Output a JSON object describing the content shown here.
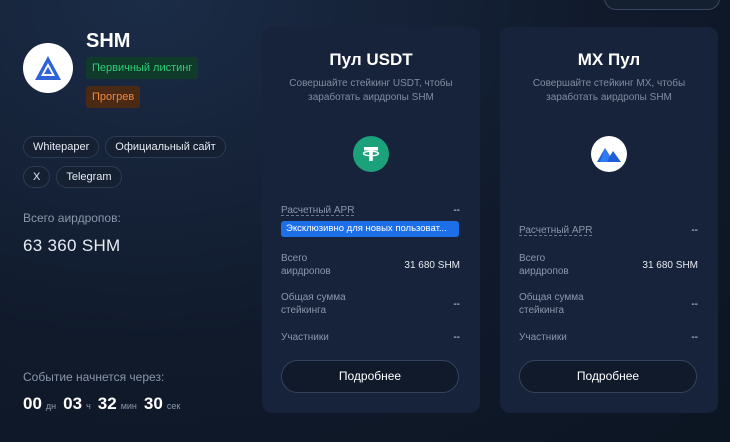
{
  "token": {
    "name": "SHM",
    "badges": [
      "Первичный листинг",
      "Прогрев"
    ],
    "links": [
      "Whitepaper",
      "Официальный сайт",
      "X",
      "Telegram"
    ],
    "total_airdrops_label": "Всего аирдропов:",
    "total_airdrops_value": "63 360 SHM"
  },
  "event": {
    "label": "Событие начнется через:",
    "days": "00",
    "days_unit": "дн",
    "hours": "03",
    "hours_unit": "ч",
    "minutes": "32",
    "minutes_unit": "мин",
    "seconds": "30",
    "seconds_unit": "сек"
  },
  "pools": [
    {
      "title": "Пул USDT",
      "description": "Совершайте стейкинг USDT, чтобы заработать аирдропы SHM",
      "icon": "tether-icon",
      "apr_label": "Расчетный APR",
      "apr_value": "--",
      "exclusive_label": "Эксклюзивно для новых пользоват...",
      "total_label": "Всего аирдропов",
      "total_value": "31 680 SHM",
      "staking_label": "Общая сумма стейкинга",
      "staking_value": "--",
      "participants_label": "Участники",
      "participants_value": "--",
      "button": "Подробнее"
    },
    {
      "title": "MX Пул",
      "description": "Совершайте стейкинг MX, чтобы заработать аирдропы SHM",
      "icon": "mx-icon",
      "apr_label": "Расчетный APR",
      "apr_value": "--",
      "total_label": "Всего аирдропов",
      "total_value": "31 680 SHM",
      "staking_label": "Общая сумма стейкинга",
      "staking_value": "--",
      "participants_label": "Участники",
      "participants_value": "--",
      "button": "Подробнее"
    }
  ],
  "colors": {
    "primary_badge_text": "#2fcf7a",
    "warm_badge_text": "#f08a3a",
    "exclusive_bg": "#1d6fe8",
    "tether": "#1ba27a"
  }
}
